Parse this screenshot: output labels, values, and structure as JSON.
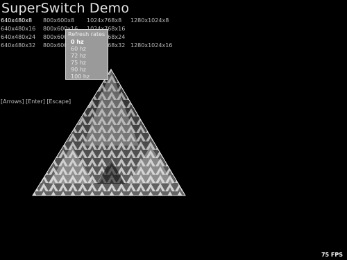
{
  "title": "SuperSwitch Demo",
  "modes": [
    [
      "640x480x8",
      "800x600x8",
      "1024x768x8",
      "1280x1024x8"
    ],
    [
      "640x480x16",
      "800x600x16",
      "1024x768x16",
      ""
    ],
    [
      "640x480x24",
      "800x600x24",
      "1024x768x24",
      ""
    ],
    [
      "640x480x32",
      "800x600x32",
      "1024x768x32",
      "1280x1024x16"
    ]
  ],
  "selected_mode": "640x480x8",
  "refresh_popup": {
    "title": "Refresh rates",
    "rates": [
      "0 hz",
      "60 hz",
      "72 hz",
      "75 hz",
      "90 hz",
      "100 hz"
    ],
    "selected": "0 hz"
  },
  "hint": "[Arrows]  [Enter]  [Escape]",
  "fps": "75 FPS",
  "colors": {
    "background": "#000000",
    "popup": "#9a9a9a",
    "text": "#bdbdbd"
  }
}
